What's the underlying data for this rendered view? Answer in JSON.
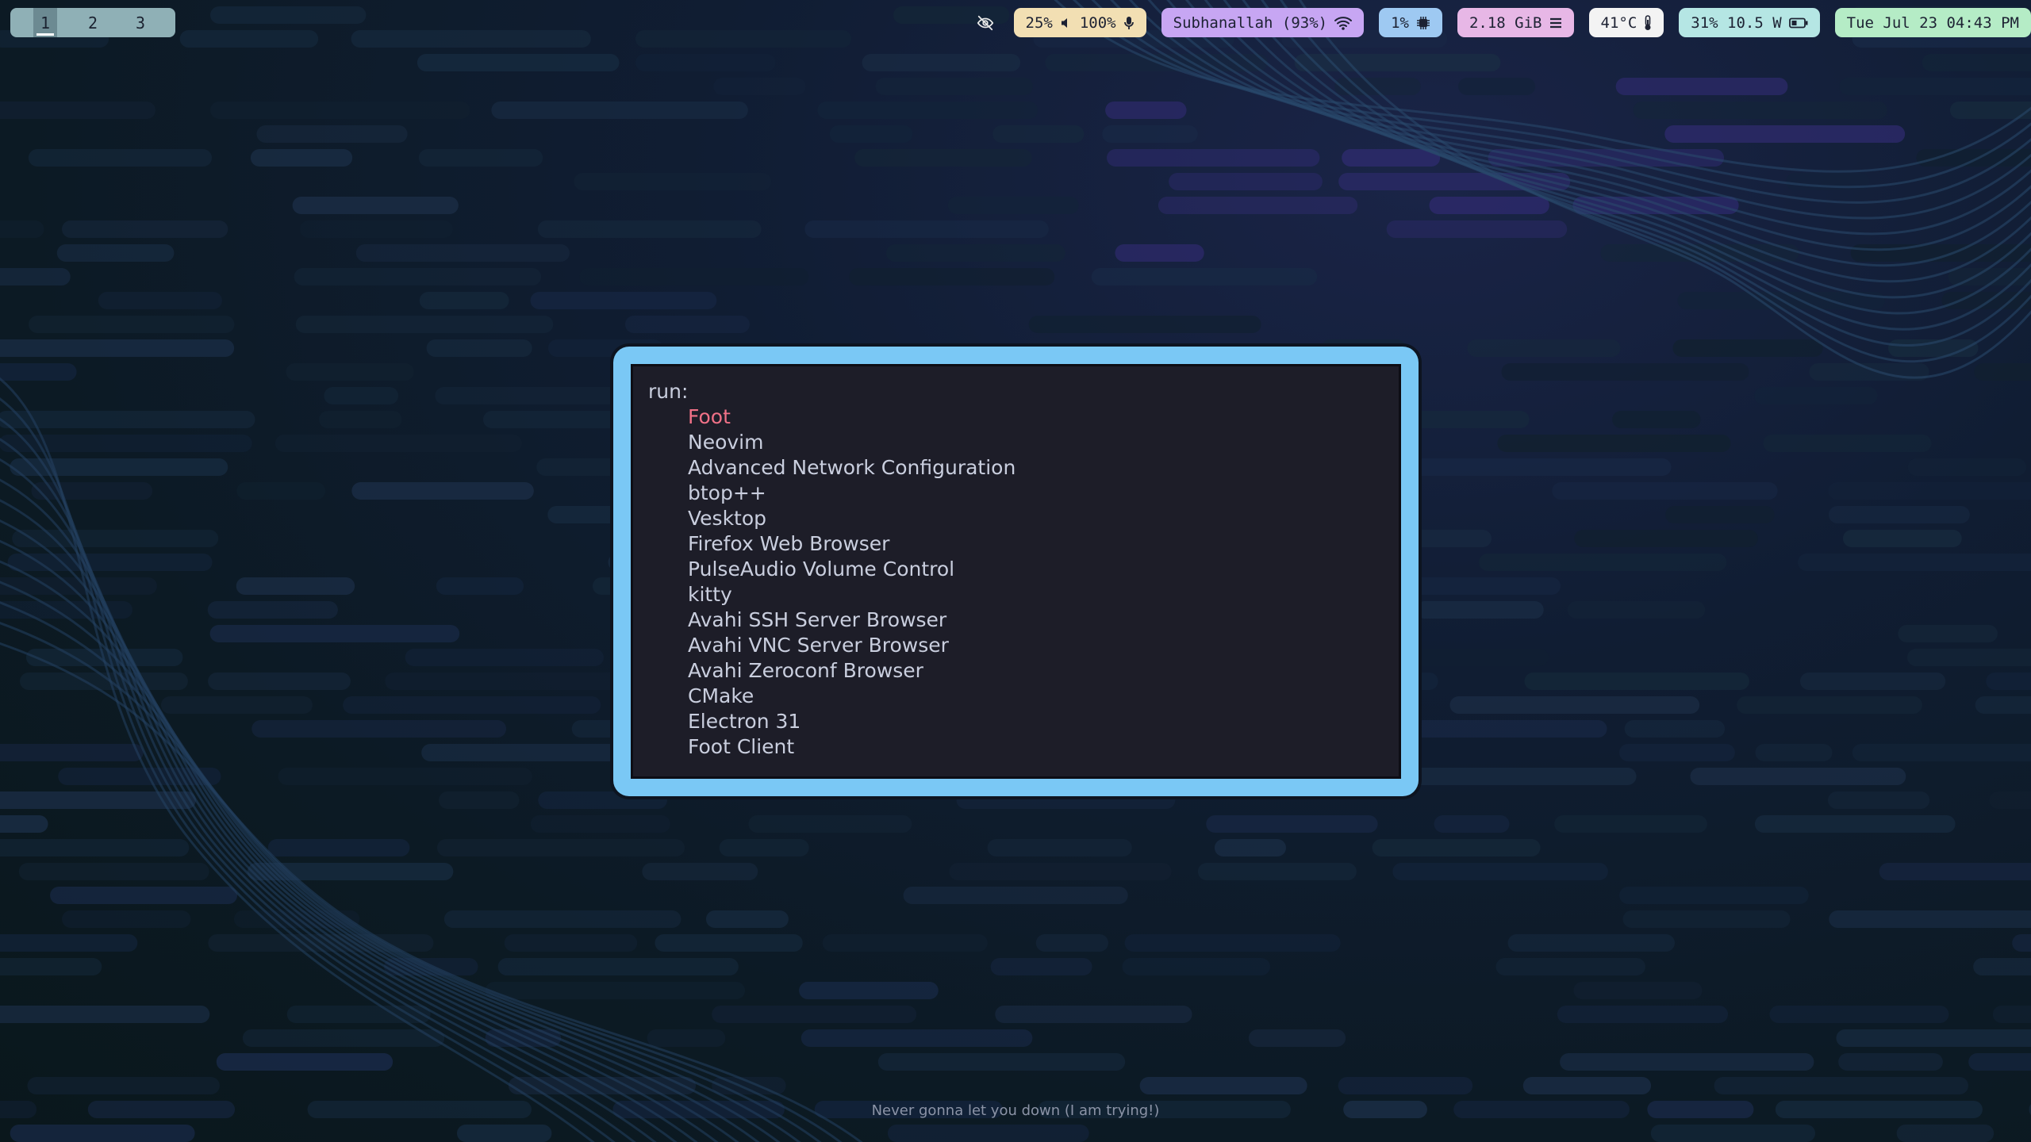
{
  "workspaces": [
    {
      "label": "1",
      "active": true
    },
    {
      "label": "2",
      "active": false
    },
    {
      "label": "3",
      "active": false
    }
  ],
  "topbar": {
    "idle_inhibitor_icon": "eye-off-icon",
    "audio": {
      "volume": "25%",
      "mic": "100%",
      "color": "#f2dfb3"
    },
    "network": {
      "ssid_signal": "Subhanallah (93%)",
      "color": "#c7a6f3"
    },
    "cpu": {
      "usage": "1%",
      "color": "#9ec9f2"
    },
    "memory": {
      "used": "2.18 GiB",
      "color": "#e7b7e6"
    },
    "temperature": {
      "value": "41°C",
      "color": "#f3f3f3"
    },
    "battery": {
      "status": "31% 10.5 W",
      "color": "#b5e6e4"
    },
    "clock": {
      "datetime": "Tue Jul 23 04:43 PM",
      "color": "#b5ecc6"
    }
  },
  "launcher": {
    "prompt": "run:",
    "selected_index": 0,
    "entries": [
      "Foot",
      "Neovim",
      "Advanced Network Configuration",
      "btop++",
      "Vesktop",
      "Firefox Web Browser",
      "PulseAudio Volume Control",
      "kitty",
      "Avahi SSH Server Browser",
      "Avahi VNC Server Browser",
      "Avahi Zeroconf Browser",
      "CMake",
      "Electron 31",
      "Foot Client"
    ],
    "border_color": "#7ac8f5",
    "selected_color": "#f07187"
  },
  "footer_text": "Never gonna let you down (I am trying!)"
}
